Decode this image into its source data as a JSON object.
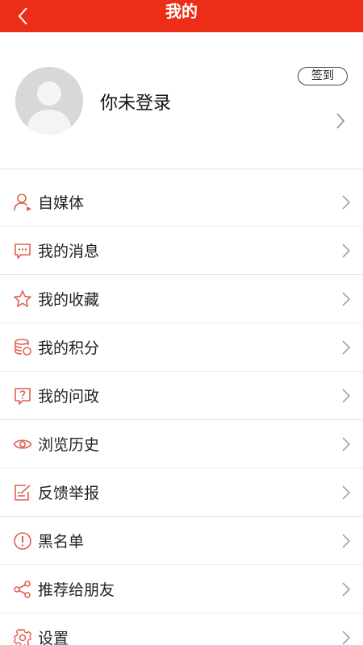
{
  "header": {
    "title": "我的",
    "back_icon": "chevron-left-icon",
    "background": "#ec2d18"
  },
  "profile": {
    "username": "你未登录",
    "signin_label": "签到",
    "avatar_icon": "default-avatar-icon"
  },
  "menu": {
    "accent_color": "#e0604f",
    "items": [
      {
        "label": "自媒体",
        "icon": "user-media-icon"
      },
      {
        "label": "我的消息",
        "icon": "message-icon"
      },
      {
        "label": "我的收藏",
        "icon": "star-icon"
      },
      {
        "label": "我的积分",
        "icon": "coins-icon"
      },
      {
        "label": "我的问政",
        "icon": "question-icon"
      },
      {
        "label": "浏览历史",
        "icon": "eye-icon"
      },
      {
        "label": "反馈举报",
        "icon": "edit-icon"
      },
      {
        "label": "黑名单",
        "icon": "alert-icon"
      },
      {
        "label": "推荐给朋友",
        "icon": "share-icon"
      },
      {
        "label": "设置",
        "icon": "gear-icon"
      }
    ]
  }
}
